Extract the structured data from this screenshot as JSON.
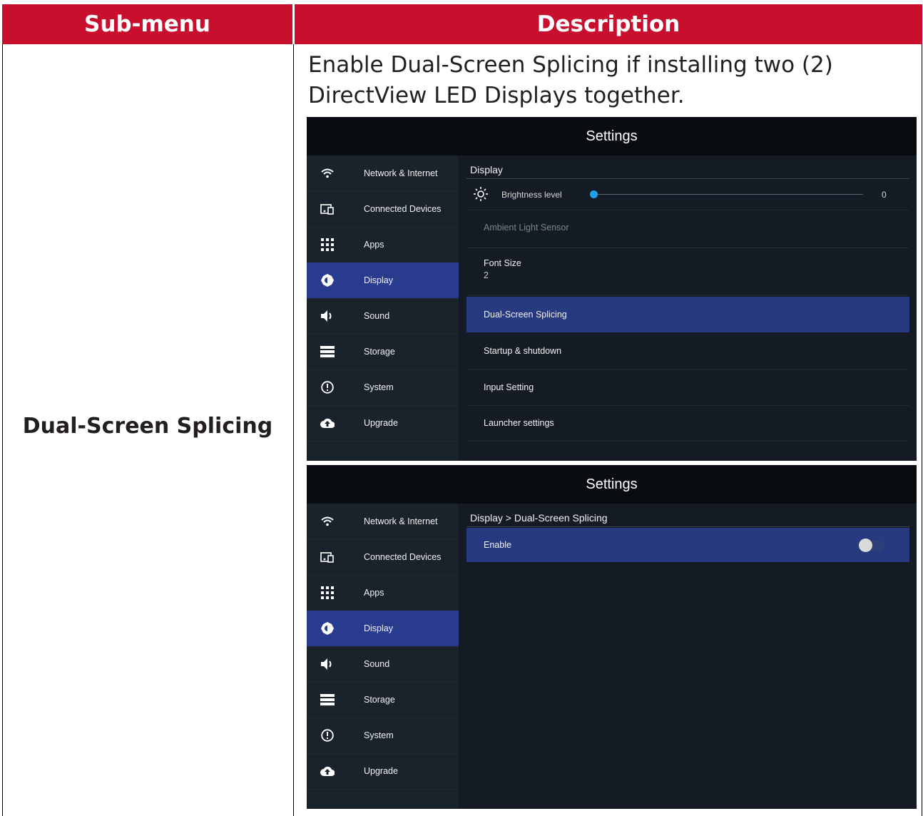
{
  "table": {
    "header_submenu": "Sub-menu",
    "header_description": "Description",
    "submenu_name": "Dual-Screen Splicing",
    "description": "Enable Dual-Screen Splicing if installing two (2) DirectView LED Displays together."
  },
  "colors": {
    "header_bg": "#c8102e",
    "sidebar_active": "#293b8f",
    "row_active": "#27397f",
    "slider": "#1ea1f2"
  },
  "sidebar": {
    "items": [
      {
        "label": "Network & Internet",
        "icon": "wifi-icon"
      },
      {
        "label": "Connected Devices",
        "icon": "connected-devices-icon"
      },
      {
        "label": "Apps",
        "icon": "apps-grid-icon"
      },
      {
        "label": "Display",
        "icon": "brightness-icon",
        "active": true
      },
      {
        "label": "Sound",
        "icon": "speaker-icon"
      },
      {
        "label": "Storage",
        "icon": "storage-icon"
      },
      {
        "label": "System",
        "icon": "info-icon"
      },
      {
        "label": "Upgrade",
        "icon": "cloud-upload-icon"
      }
    ]
  },
  "screen1": {
    "title": "Settings",
    "section": "Display",
    "brightness": {
      "label": "Brightness level",
      "value": "0",
      "level": 0
    },
    "ambient": "Ambient Light Sensor",
    "font_size": {
      "label": "Font Size",
      "value": "2"
    },
    "dual": "Dual-Screen Splicing",
    "startup": "Startup & shutdown",
    "input": "Input Setting",
    "launcher": "Launcher settings"
  },
  "screen2": {
    "title": "Settings",
    "breadcrumb": "Display > Dual-Screen Splicing",
    "enable_label": "Enable",
    "enable_on": false
  }
}
